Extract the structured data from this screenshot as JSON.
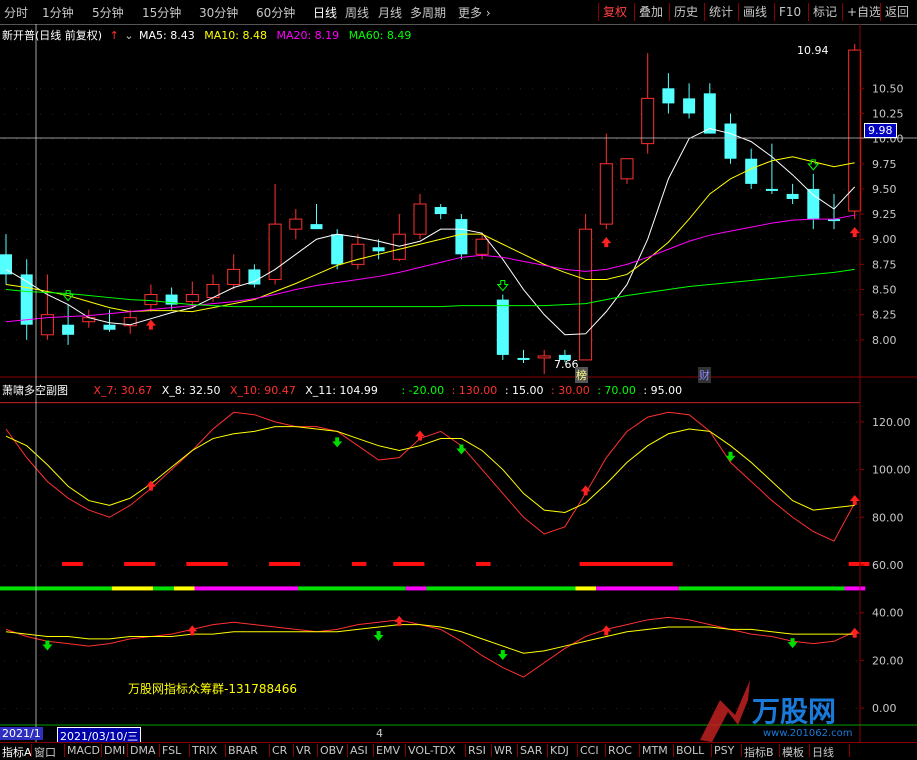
{
  "toolbar": {
    "periods": [
      "分时",
      "1分钟",
      "5分钟",
      "15分钟",
      "30分钟",
      "60分钟",
      "日线",
      "周线",
      "月线",
      "多周期",
      "更多 ›"
    ],
    "active_period": "日线",
    "right_buttons": [
      "复权",
      "叠加",
      "历史",
      "统计",
      "画线",
      "F10",
      "标记",
      "+自选",
      "返回"
    ]
  },
  "main_legend": {
    "title": "新开普(日线 前复权)",
    "ma5": "MA5: 8.43",
    "ma10": "MA10: 8.48",
    "ma20": "MA20: 8.19",
    "ma60": "MA60: 8.49",
    "colors": {
      "ma5": "#ffffff",
      "ma10": "#ffff00",
      "ma20": "#ff00ff",
      "ma60": "#00ff00"
    }
  },
  "sub_legend": {
    "title": "萧啸多空副图",
    "items": [
      "X_7: 30.67",
      "X_8: 32.50",
      "X_10: 90.47",
      "X_11: 104.99",
      ": -20.00",
      ": 130.00",
      ": 15.00",
      ": 30.00",
      ": 70.00",
      ": 95.00"
    ],
    "colors": [
      "#ff3030",
      "#ffffff",
      "#ff3030",
      "#ffffff",
      "#00ff00",
      "#ff3030",
      "#ffffff",
      "#ff3030",
      "#00ff00",
      "#ffffff"
    ]
  },
  "annotations": {
    "high_label": "10.94",
    "low_label": "7.66",
    "current_price_tag": "9.98",
    "badge_bang": "榜",
    "badge_cai": "财",
    "watermark": "万股网指标众筹群-131788466",
    "logo_text": "万股网",
    "logo_url": "www.201062.com"
  },
  "chart_data": [
    {
      "type": "candlestick",
      "title": "新开普(日线 前复权)",
      "ylim": [
        7.7,
        11.0
      ],
      "yticks": [
        8.0,
        8.25,
        8.5,
        8.75,
        9.0,
        9.25,
        9.5,
        9.75,
        10.0,
        10.25,
        10.5
      ],
      "candles": [
        {
          "o": 8.85,
          "h": 9.05,
          "l": 8.55,
          "c": 8.65
        },
        {
          "o": 8.65,
          "h": 8.8,
          "l": 8.0,
          "c": 8.15
        },
        {
          "o": 8.05,
          "h": 8.65,
          "l": 8.0,
          "c": 8.25
        },
        {
          "o": 8.15,
          "h": 8.35,
          "l": 7.95,
          "c": 8.05
        },
        {
          "o": 8.18,
          "h": 8.3,
          "l": 8.12,
          "c": 8.22
        },
        {
          "o": 8.15,
          "h": 8.3,
          "l": 8.08,
          "c": 8.1
        },
        {
          "o": 8.14,
          "h": 8.3,
          "l": 8.06,
          "c": 8.22
        },
        {
          "o": 8.35,
          "h": 8.55,
          "l": 8.28,
          "c": 8.45
        },
        {
          "o": 8.45,
          "h": 8.52,
          "l": 8.3,
          "c": 8.35
        },
        {
          "o": 8.38,
          "h": 8.58,
          "l": 8.32,
          "c": 8.45
        },
        {
          "o": 8.42,
          "h": 8.65,
          "l": 8.38,
          "c": 8.55
        },
        {
          "o": 8.55,
          "h": 8.85,
          "l": 8.5,
          "c": 8.7
        },
        {
          "o": 8.7,
          "h": 8.75,
          "l": 8.52,
          "c": 8.55
        },
        {
          "o": 8.6,
          "h": 9.55,
          "l": 8.55,
          "c": 9.15
        },
        {
          "o": 9.1,
          "h": 9.3,
          "l": 9.0,
          "c": 9.2
        },
        {
          "o": 9.15,
          "h": 9.35,
          "l": 9.1,
          "c": 9.1
        },
        {
          "o": 9.05,
          "h": 9.1,
          "l": 8.7,
          "c": 8.75
        },
        {
          "o": 8.75,
          "h": 9.05,
          "l": 8.7,
          "c": 8.95
        },
        {
          "o": 8.92,
          "h": 9.0,
          "l": 8.8,
          "c": 8.88
        },
        {
          "o": 8.8,
          "h": 9.25,
          "l": 8.78,
          "c": 9.05
        },
        {
          "o": 9.05,
          "h": 9.45,
          "l": 9.0,
          "c": 9.35
        },
        {
          "o": 9.32,
          "h": 9.35,
          "l": 9.2,
          "c": 9.25
        },
        {
          "o": 9.2,
          "h": 9.25,
          "l": 8.8,
          "c": 8.85
        },
        {
          "o": 8.85,
          "h": 9.05,
          "l": 8.8,
          "c": 9.0
        },
        {
          "o": 8.4,
          "h": 8.45,
          "l": 7.8,
          "c": 7.85
        },
        {
          "o": 7.82,
          "h": 7.9,
          "l": 7.77,
          "c": 7.8
        },
        {
          "o": 7.82,
          "h": 7.9,
          "l": 7.66,
          "c": 7.84
        },
        {
          "o": 7.85,
          "h": 7.9,
          "l": 7.78,
          "c": 7.8
        },
        {
          "o": 7.8,
          "h": 9.25,
          "l": 7.8,
          "c": 9.1
        },
        {
          "o": 9.15,
          "h": 10.05,
          "l": 9.1,
          "c": 9.75
        },
        {
          "o": 9.6,
          "h": 9.8,
          "l": 9.55,
          "c": 9.8
        },
        {
          "o": 9.95,
          "h": 10.85,
          "l": 9.85,
          "c": 10.4
        },
        {
          "o": 10.5,
          "h": 10.65,
          "l": 10.25,
          "c": 10.35
        },
        {
          "o": 10.4,
          "h": 10.55,
          "l": 10.2,
          "c": 10.25
        },
        {
          "o": 10.45,
          "h": 10.55,
          "l": 10.05,
          "c": 10.05
        },
        {
          "o": 10.15,
          "h": 10.25,
          "l": 9.75,
          "c": 9.8
        },
        {
          "o": 9.8,
          "h": 9.9,
          "l": 9.5,
          "c": 9.55
        },
        {
          "o": 9.5,
          "h": 9.95,
          "l": 9.45,
          "c": 9.48
        },
        {
          "o": 9.45,
          "h": 9.55,
          "l": 9.35,
          "c": 9.4
        },
        {
          "o": 9.5,
          "h": 9.65,
          "l": 9.1,
          "c": 9.2
        },
        {
          "o": 9.2,
          "h": 9.45,
          "l": 9.1,
          "c": 9.18
        },
        {
          "o": 9.28,
          "h": 10.94,
          "l": 9.2,
          "c": 10.88
        }
      ],
      "series": [
        {
          "name": "MA5",
          "color": "#ffffff",
          "values": [
            8.7,
            8.58,
            8.45,
            8.35,
            8.22,
            8.17,
            8.15,
            8.21,
            8.27,
            8.32,
            8.42,
            8.52,
            8.58,
            8.7,
            8.85,
            9.0,
            9.05,
            9.02,
            8.98,
            8.93,
            8.98,
            9.1,
            9.1,
            9.06,
            8.8,
            8.5,
            8.25,
            8.05,
            8.06,
            8.28,
            8.55,
            9.0,
            9.6,
            10.0,
            10.1,
            10.05,
            9.97,
            9.82,
            9.64,
            9.44,
            9.3,
            9.52
          ]
        },
        {
          "name": "MA10",
          "color": "#ffff00",
          "values": [
            8.55,
            8.52,
            8.48,
            8.44,
            8.38,
            8.32,
            8.28,
            8.29,
            8.29,
            8.28,
            8.32,
            8.36,
            8.4,
            8.48,
            8.56,
            8.65,
            8.74,
            8.8,
            8.85,
            8.9,
            8.95,
            9.0,
            9.05,
            9.05,
            8.95,
            8.85,
            8.75,
            8.67,
            8.6,
            8.6,
            8.65,
            8.8,
            8.97,
            9.2,
            9.45,
            9.6,
            9.7,
            9.78,
            9.82,
            9.77,
            9.72,
            9.76
          ]
        },
        {
          "name": "MA20",
          "color": "#ff00ff",
          "values": [
            8.18,
            8.2,
            8.22,
            8.23,
            8.24,
            8.26,
            8.28,
            8.3,
            8.32,
            8.34,
            8.36,
            8.38,
            8.41,
            8.45,
            8.5,
            8.54,
            8.57,
            8.6,
            8.63,
            8.67,
            8.72,
            8.77,
            8.82,
            8.84,
            8.82,
            8.78,
            8.74,
            8.7,
            8.68,
            8.7,
            8.75,
            8.82,
            8.9,
            8.98,
            9.04,
            9.08,
            9.12,
            9.16,
            9.19,
            9.2,
            9.2,
            9.24
          ]
        },
        {
          "name": "MA60",
          "color": "#00ff00",
          "values": [
            8.5,
            8.48,
            8.47,
            8.46,
            8.44,
            8.42,
            8.4,
            8.39,
            8.37,
            8.35,
            8.34,
            8.33,
            8.33,
            8.33,
            8.33,
            8.33,
            8.33,
            8.33,
            8.33,
            8.33,
            8.33,
            8.33,
            8.34,
            8.34,
            8.34,
            8.34,
            8.34,
            8.35,
            8.36,
            8.4,
            8.44,
            8.47,
            8.5,
            8.53,
            8.55,
            8.57,
            8.59,
            8.61,
            8.63,
            8.65,
            8.67,
            8.7
          ]
        }
      ],
      "up_arrows": [
        7,
        29,
        41
      ],
      "down_arrows": [
        3,
        24,
        39
      ]
    },
    {
      "type": "line",
      "title": "萧啸多空副图",
      "ylim": [
        -5,
        130
      ],
      "yticks": [
        0,
        20,
        40,
        60,
        80,
        100,
        120
      ],
      "series": [
        {
          "name": "X_10",
          "color": "#ff3030",
          "values": [
            117,
            105,
            95,
            88,
            83,
            80,
            85,
            92,
            100,
            108,
            117,
            124,
            123,
            120,
            118,
            118,
            116,
            110,
            104,
            105,
            113,
            116,
            110,
            100,
            90,
            80,
            73,
            76,
            90,
            105,
            116,
            122,
            124,
            123,
            116,
            103,
            95,
            87,
            80,
            74,
            70,
            86
          ]
        },
        {
          "name": "X_11",
          "color": "#ffff00",
          "values": [
            114,
            110,
            102,
            93,
            87,
            85,
            88,
            94,
            101,
            108,
            113,
            115,
            116,
            118,
            118,
            117,
            116,
            113,
            110,
            108,
            110,
            113,
            113,
            108,
            100,
            90,
            83,
            82,
            86,
            94,
            103,
            110,
            115,
            117,
            116,
            110,
            103,
            95,
            87,
            83,
            84,
            85
          ]
        },
        {
          "name": "X_7",
          "color": "#ff3030",
          "values": [
            33,
            30,
            28,
            27,
            26,
            27,
            29,
            30,
            31,
            33,
            35,
            36,
            35,
            34,
            33,
            32,
            33,
            35,
            36,
            37,
            35,
            33,
            28,
            22,
            17,
            13,
            19,
            25,
            30,
            33,
            35,
            37,
            38,
            37,
            35,
            33,
            31,
            30,
            28,
            27,
            28,
            32
          ]
        },
        {
          "name": "X_8",
          "color": "#ffff00",
          "values": [
            32,
            31,
            30,
            30,
            29,
            29,
            30,
            30,
            30,
            31,
            31,
            32,
            32,
            32,
            32,
            32,
            32,
            33,
            34,
            35,
            35,
            34,
            32,
            29,
            26,
            23,
            24,
            26,
            28,
            30,
            32,
            33,
            34,
            34,
            34,
            33,
            33,
            32,
            31,
            31,
            31,
            31
          ]
        }
      ],
      "upper_arrows_up": [
        7,
        20,
        28,
        41
      ],
      "upper_arrows_down": [
        16,
        22,
        35
      ],
      "lower_arrows_up": [
        9,
        19,
        29,
        41
      ],
      "lower_arrows_down": [
        2,
        18,
        24,
        38
      ]
    }
  ],
  "bottom_tabs": [
    "指标A",
    "窗口",
    "MACD",
    "DMI",
    "DMA",
    "FSL",
    "TRIX",
    "BRAR",
    "CR",
    "VR",
    "OBV",
    "ASI",
    "EMV",
    "VOL-TDX",
    "RSI",
    "WR",
    "SAR",
    "KDJ",
    "CCI",
    "ROC",
    "MTM",
    "BOLL",
    "PSY",
    "指标B",
    "模板",
    "日线"
  ],
  "datebar": {
    "left_date": "2021/1",
    "cursor_date": "2021/03/10/三",
    "num": "4"
  }
}
